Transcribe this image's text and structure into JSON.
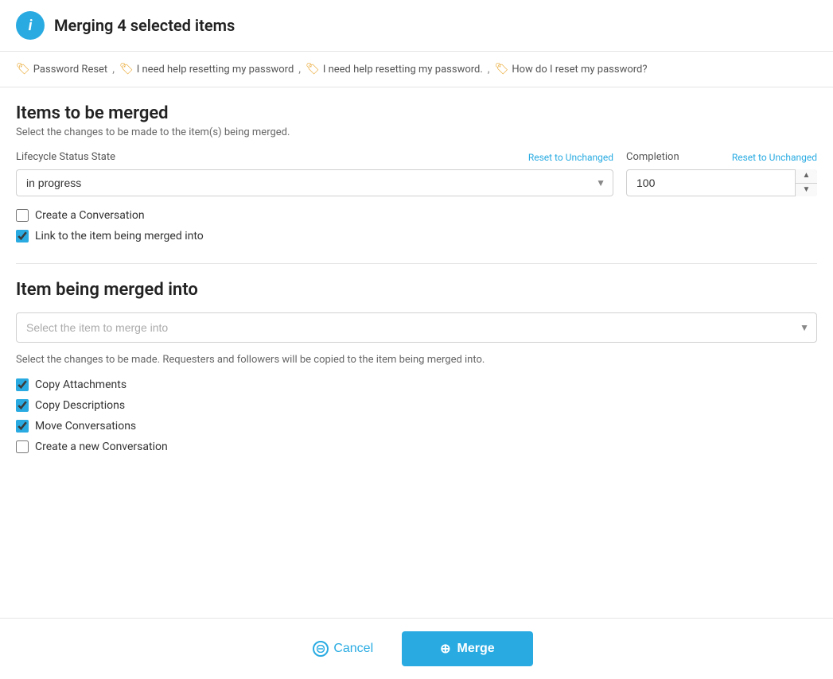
{
  "header": {
    "title": "Merging 4 selected items",
    "icon_label": "i"
  },
  "tags": [
    {
      "label": "Password Reset"
    },
    {
      "label": "I need help resetting my password"
    },
    {
      "label": "I need help resetting my password."
    },
    {
      "label": "How do I reset my password?"
    }
  ],
  "items_to_merge": {
    "title": "Items to be merged",
    "subtitle": "Select the changes to be made to the item(s) being merged.",
    "lifecycle_label": "Lifecycle Status State",
    "lifecycle_reset": "Reset to Unchanged",
    "lifecycle_value": "in progress",
    "completion_label": "Completion",
    "completion_reset": "Reset to Unchanged",
    "completion_value": "100",
    "create_conversation_label": "Create a Conversation",
    "create_conversation_checked": false,
    "link_to_item_label": "Link to the item being merged into",
    "link_to_item_checked": true
  },
  "item_merged_into": {
    "title": "Item being merged into",
    "select_placeholder": "Select the item to merge into",
    "helper_text": "Select the changes to be made. Requesters and followers will be copied to the item being merged into.",
    "copy_attachments_label": "Copy Attachments",
    "copy_attachments_checked": true,
    "copy_descriptions_label": "Copy Descriptions",
    "copy_descriptions_checked": true,
    "move_conversations_label": "Move Conversations",
    "move_conversations_checked": true,
    "create_new_conversation_label": "Create a new Conversation",
    "create_new_conversation_checked": false
  },
  "footer": {
    "cancel_label": "Cancel",
    "merge_label": "Merge"
  }
}
